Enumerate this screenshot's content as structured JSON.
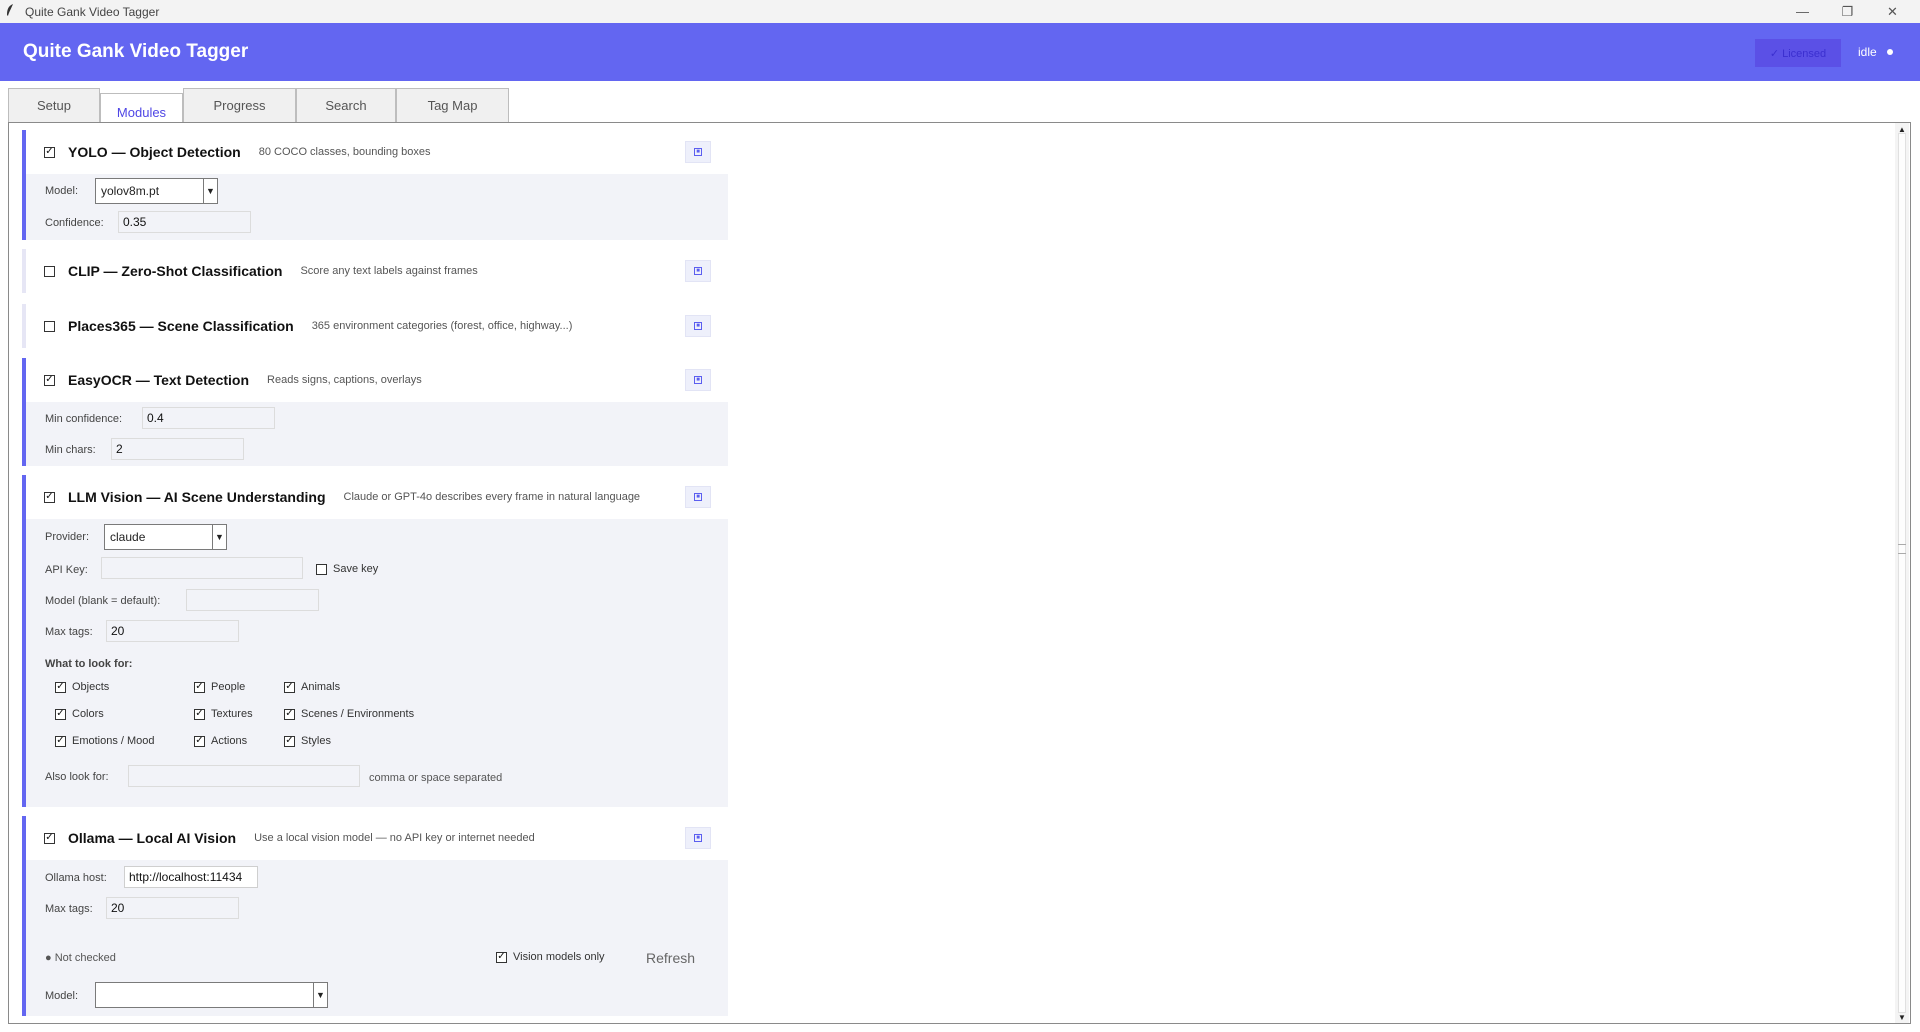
{
  "window": {
    "title": "Quite Gank Video Tagger",
    "minimize_glyph": "—",
    "restore_glyph": "❐",
    "close_glyph": "✕"
  },
  "header": {
    "title": "Quite Gank Video Tagger",
    "license_label": "✓ Licensed",
    "status": "idle"
  },
  "tabs": [
    {
      "label": "Setup",
      "active": false
    },
    {
      "label": "Modules",
      "active": true
    },
    {
      "label": "Progress",
      "active": false
    },
    {
      "label": "Search",
      "active": false
    },
    {
      "label": "Tag Map",
      "active": false
    }
  ],
  "check_glyph": "✓",
  "modules": {
    "yolo": {
      "name": "YOLO",
      "dash": "—",
      "subtitle": "Object Detection",
      "description": "80 COCO classes, bounding boxes",
      "enabled": true,
      "model_label": "Model:",
      "model_value": "yolov8m.pt",
      "confidence_label": "Confidence:",
      "confidence_value": "0.35"
    },
    "clip": {
      "name": "CLIP",
      "dash": "—",
      "subtitle": "Zero-Shot Classification",
      "description": "Score any text labels against frames",
      "enabled": false
    },
    "places": {
      "name": "Places365",
      "dash": "—",
      "subtitle": "Scene Classification",
      "description": "365 environment categories (forest, office, highway...)",
      "enabled": false
    },
    "easyocr": {
      "name": "EasyOCR",
      "dash": "—",
      "subtitle": "Text Detection",
      "description": "Reads signs, captions, overlays",
      "enabled": true,
      "min_conf_label": "Min confidence:",
      "min_conf_value": "0.4",
      "min_chars_label": "Min chars:",
      "min_chars_value": "2"
    },
    "llm": {
      "name": "LLM Vision",
      "dash": "—",
      "subtitle": "AI Scene Understanding",
      "description": "Claude or GPT-4o describes every frame in natural language",
      "enabled": true,
      "provider_label": "Provider:",
      "provider_value": "claude",
      "api_key_label": "API Key:",
      "api_key_value": "",
      "save_key_label": "Save key",
      "save_key_checked": false,
      "model_label": "Model (blank = default):",
      "model_value": "",
      "max_tags_label": "Max tags:",
      "max_tags_value": "20",
      "look_for_label": "What to look for:",
      "look_for": {
        "objects": "Objects",
        "people": "People",
        "animals": "Animals",
        "colors": "Colors",
        "textures": "Textures",
        "scenes": "Scenes / Environments",
        "emotions": "Emotions / Mood",
        "actions": "Actions",
        "styles": "Styles"
      },
      "also_look_label": "Also look for:",
      "also_look_value": "",
      "also_look_hint": "comma or space separated"
    },
    "ollama": {
      "name": "Ollama",
      "dash": "—",
      "subtitle": "Local AI Vision",
      "description": "Use a local vision model — no API key or internet needed",
      "enabled": true,
      "host_label": "Ollama host:",
      "host_value": "http://localhost:11434",
      "max_tags_label": "Max tags:",
      "max_tags_value": "20",
      "check_status": "● Not checked",
      "vision_only_label": "Vision models only",
      "vision_only_checked": true,
      "refresh_label": "Refresh",
      "model_label": "Model:",
      "model_value": ""
    }
  },
  "icons": {
    "app": "feather-icon",
    "expand": "expand-icon",
    "dropdown": "dropdown-arrow-icon"
  },
  "colors": {
    "accent": "#6366f1",
    "body_bg": "#f2f3f8"
  }
}
